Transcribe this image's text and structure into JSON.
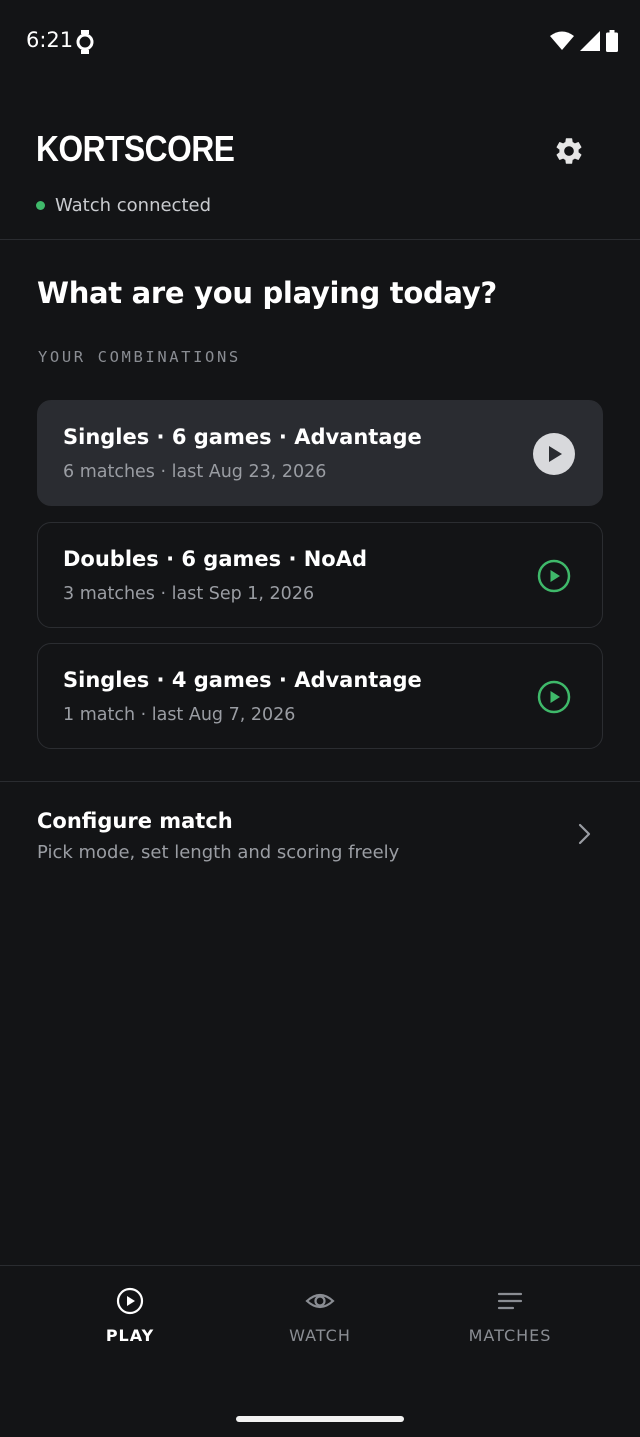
{
  "status_bar": {
    "time": "6:21"
  },
  "header": {
    "app_title": "KORTSCORE",
    "connection_status": "Watch connected"
  },
  "main": {
    "title": "What are you playing today?",
    "combinations_label": "YOUR COMBINATIONS",
    "combinations": [
      {
        "title": "Singles · 6 games · Advantage",
        "subtitle": "6 matches · last Aug 23, 2026"
      },
      {
        "title": "Doubles · 6 games · NoAd",
        "subtitle": "3 matches · last Sep 1, 2026"
      },
      {
        "title": "Singles · 4 games · Advantage",
        "subtitle": "1 match · last Aug 7, 2026"
      }
    ],
    "configure": {
      "title": "Configure match",
      "subtitle": "Pick mode, set length and scoring freely"
    }
  },
  "bottom_nav": {
    "items": [
      {
        "label": "PLAY",
        "icon": "play-circle-icon"
      },
      {
        "label": "WATCH",
        "icon": "eye-icon"
      },
      {
        "label": "MATCHES",
        "icon": "list-icon"
      }
    ]
  },
  "colors": {
    "background": "#131416",
    "card_selected": "#2a2c31",
    "accent_green": "#3fb96a",
    "muted_text": "#9a9da3"
  }
}
